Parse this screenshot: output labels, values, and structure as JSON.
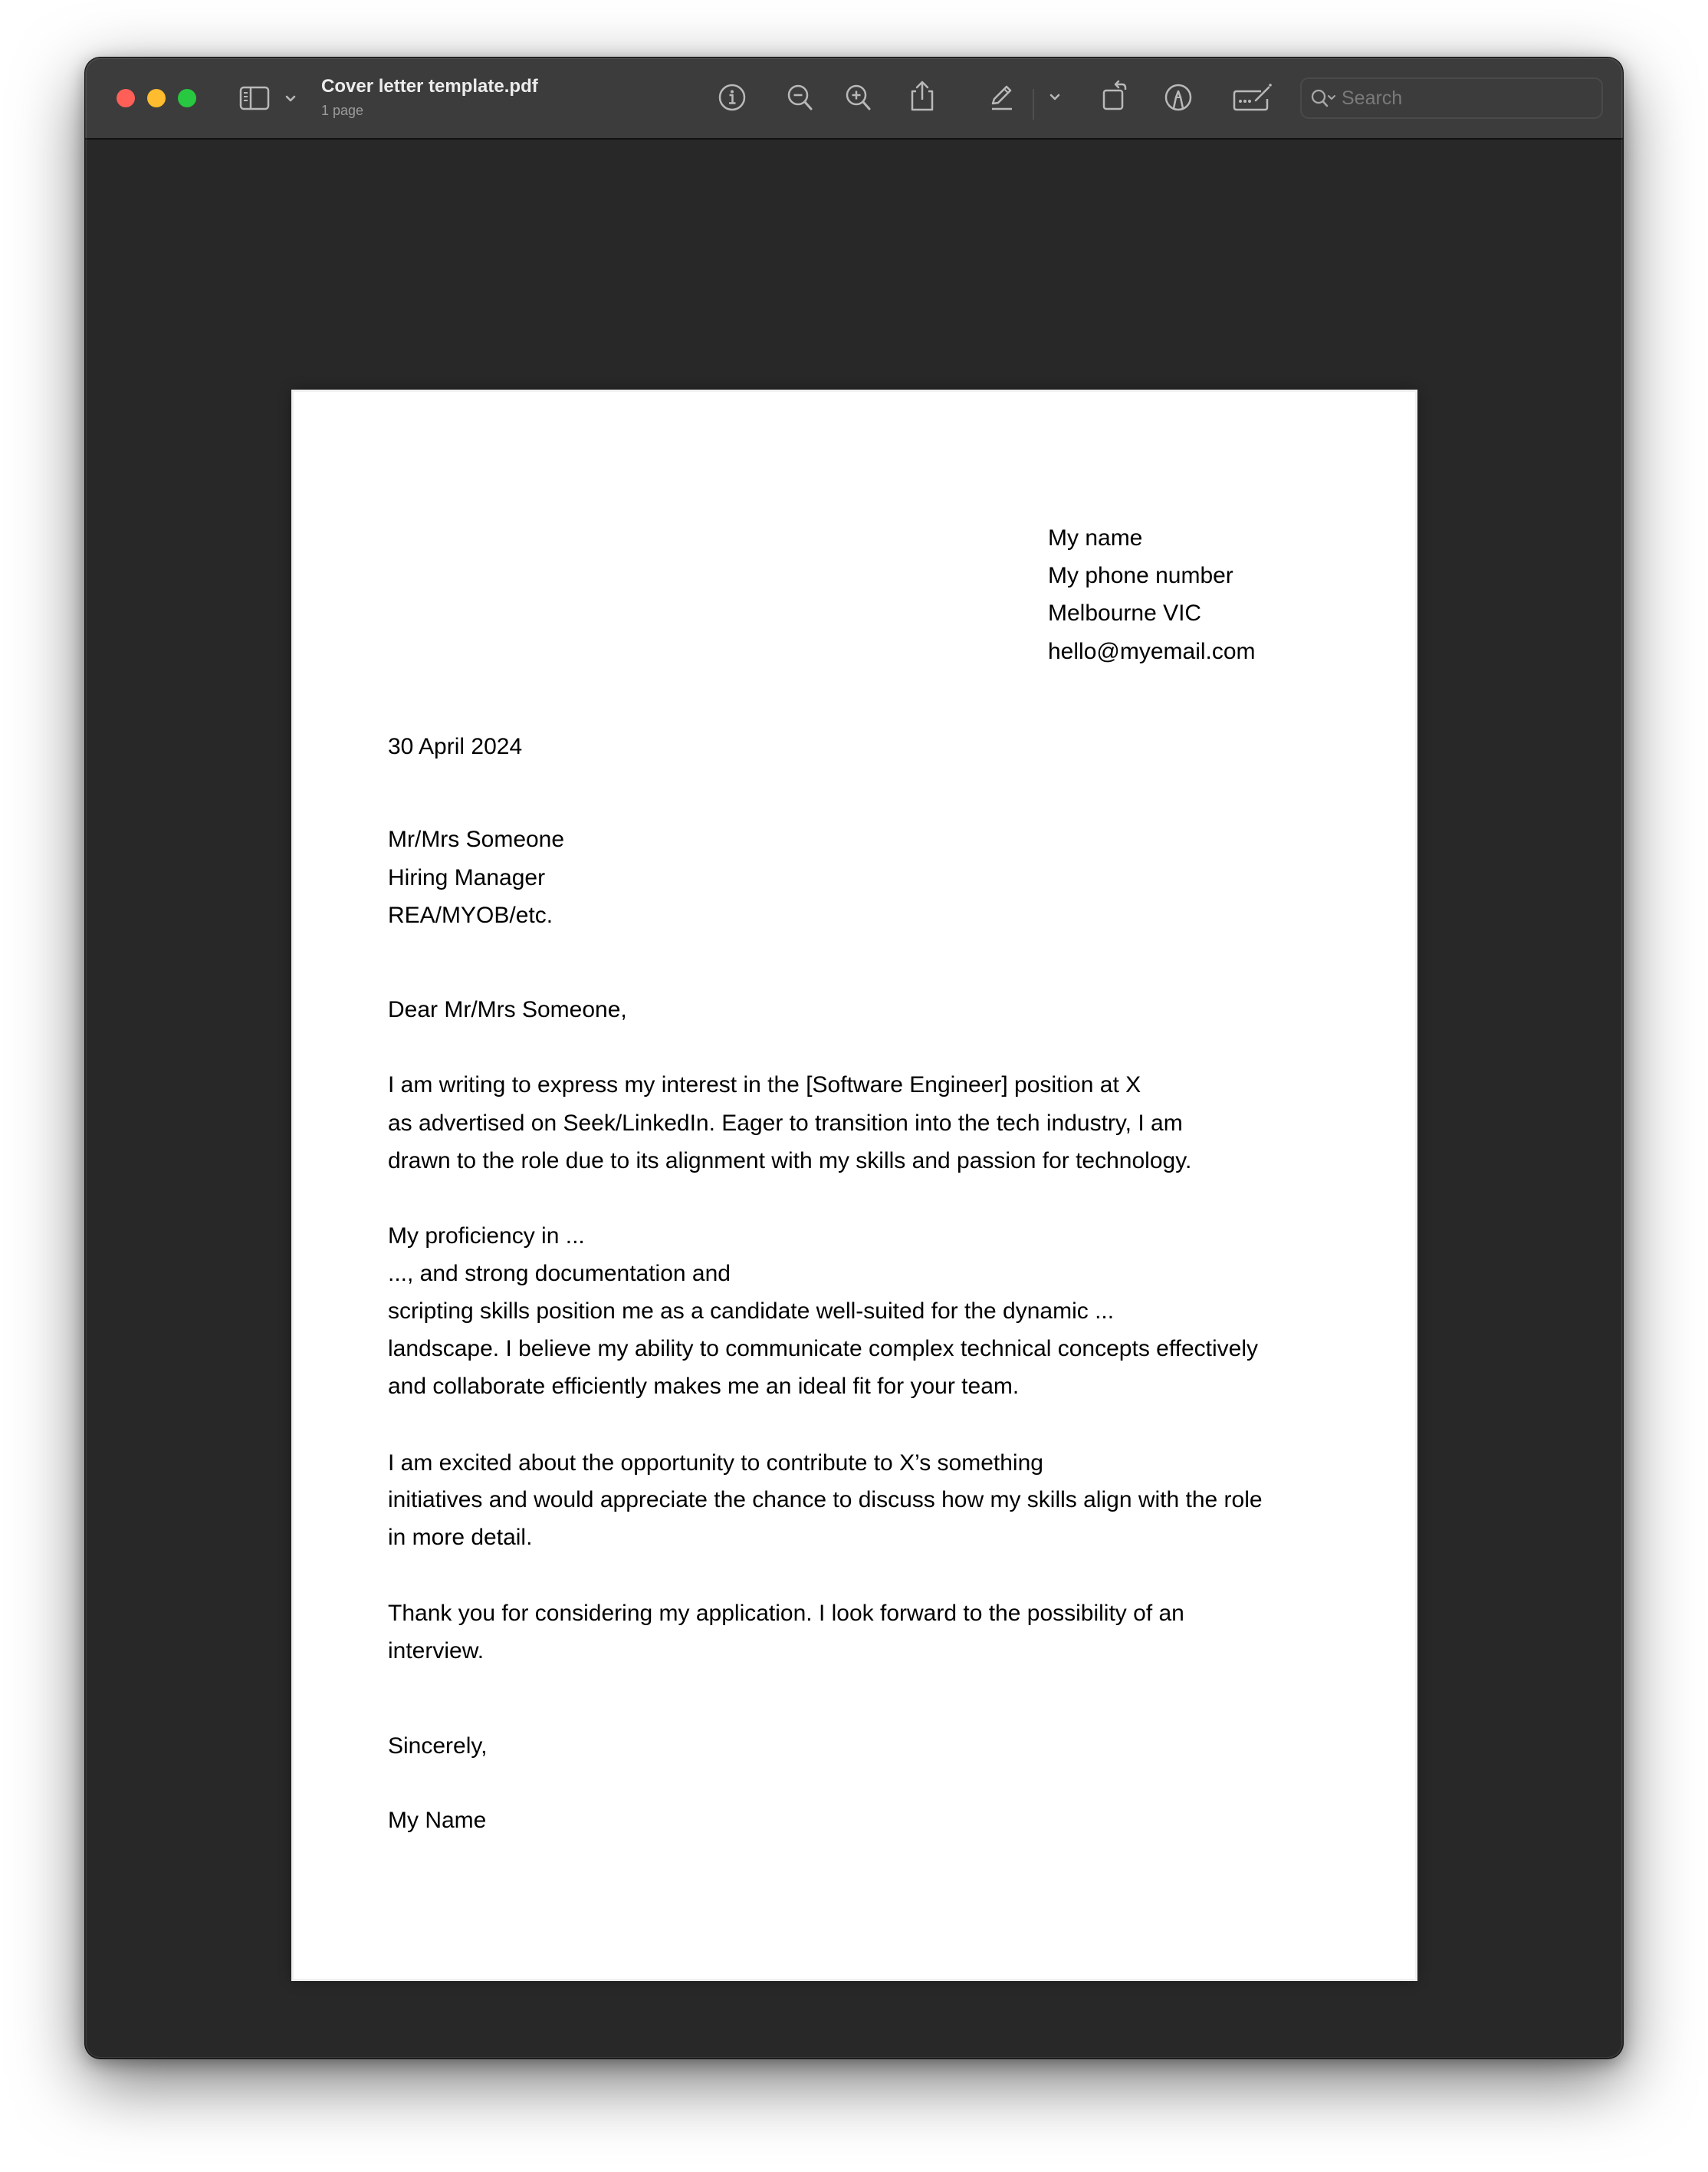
{
  "window": {
    "title": "Cover letter template.pdf",
    "subtitle": "1 page"
  },
  "toolbar": {
    "traffic_lights": [
      {
        "name": "close",
        "color": "#fe5f57"
      },
      {
        "name": "minimize",
        "color": "#febc2e"
      },
      {
        "name": "maximize",
        "color": "#28c840"
      }
    ],
    "icons": {
      "sidebar": "sidebar-toggle-icon",
      "sidebar_menu": "chevron-down-icon",
      "info": "info-icon",
      "zoom_out": "zoom-out-icon",
      "zoom_in": "zoom-in-icon",
      "share": "share-icon",
      "highlight": "pencil-highlight-icon",
      "highlight_menu": "chevron-down-icon",
      "rotate": "rotate-left-icon",
      "markup": "markup-pen-icon",
      "form": "form-filling-icon"
    },
    "search": {
      "placeholder": "Search",
      "value": ""
    }
  },
  "document": {
    "sender": [
      "My name",
      "My phone number",
      "Melbourne VIC",
      "hello@myemail.com"
    ],
    "date": "30 April 2024",
    "recipient": [
      "Mr/Mrs Someone",
      "Hiring Manager",
      "REA/MYOB/etc."
    ],
    "salutation": "Dear Mr/Mrs Someone,",
    "paragraphs": [
      [
        "I am writing to express my interest in the [Software Engineer] position at X",
        "as advertised on Seek/LinkedIn. Eager to transition into the tech industry, I am",
        "drawn to the role due to its alignment with my skills and passion for technology."
      ],
      [
        "My proficiency in ...",
        "..., and strong documentation and",
        "scripting skills position me as a candidate well-suited for the dynamic ...",
        "landscape. I believe my ability to communicate complex technical concepts effectively",
        "and collaborate efficiently makes me an ideal fit for your team."
      ],
      [
        "I am excited about the opportunity to contribute to X’s something",
        "initiatives and would appreciate the chance to discuss how my skills align with the role",
        "in more detail."
      ],
      [
        "Thank you for considering my application. I look forward to the possibility of an",
        "interview."
      ]
    ],
    "closing": "Sincerely,",
    "signature": "My Name"
  }
}
